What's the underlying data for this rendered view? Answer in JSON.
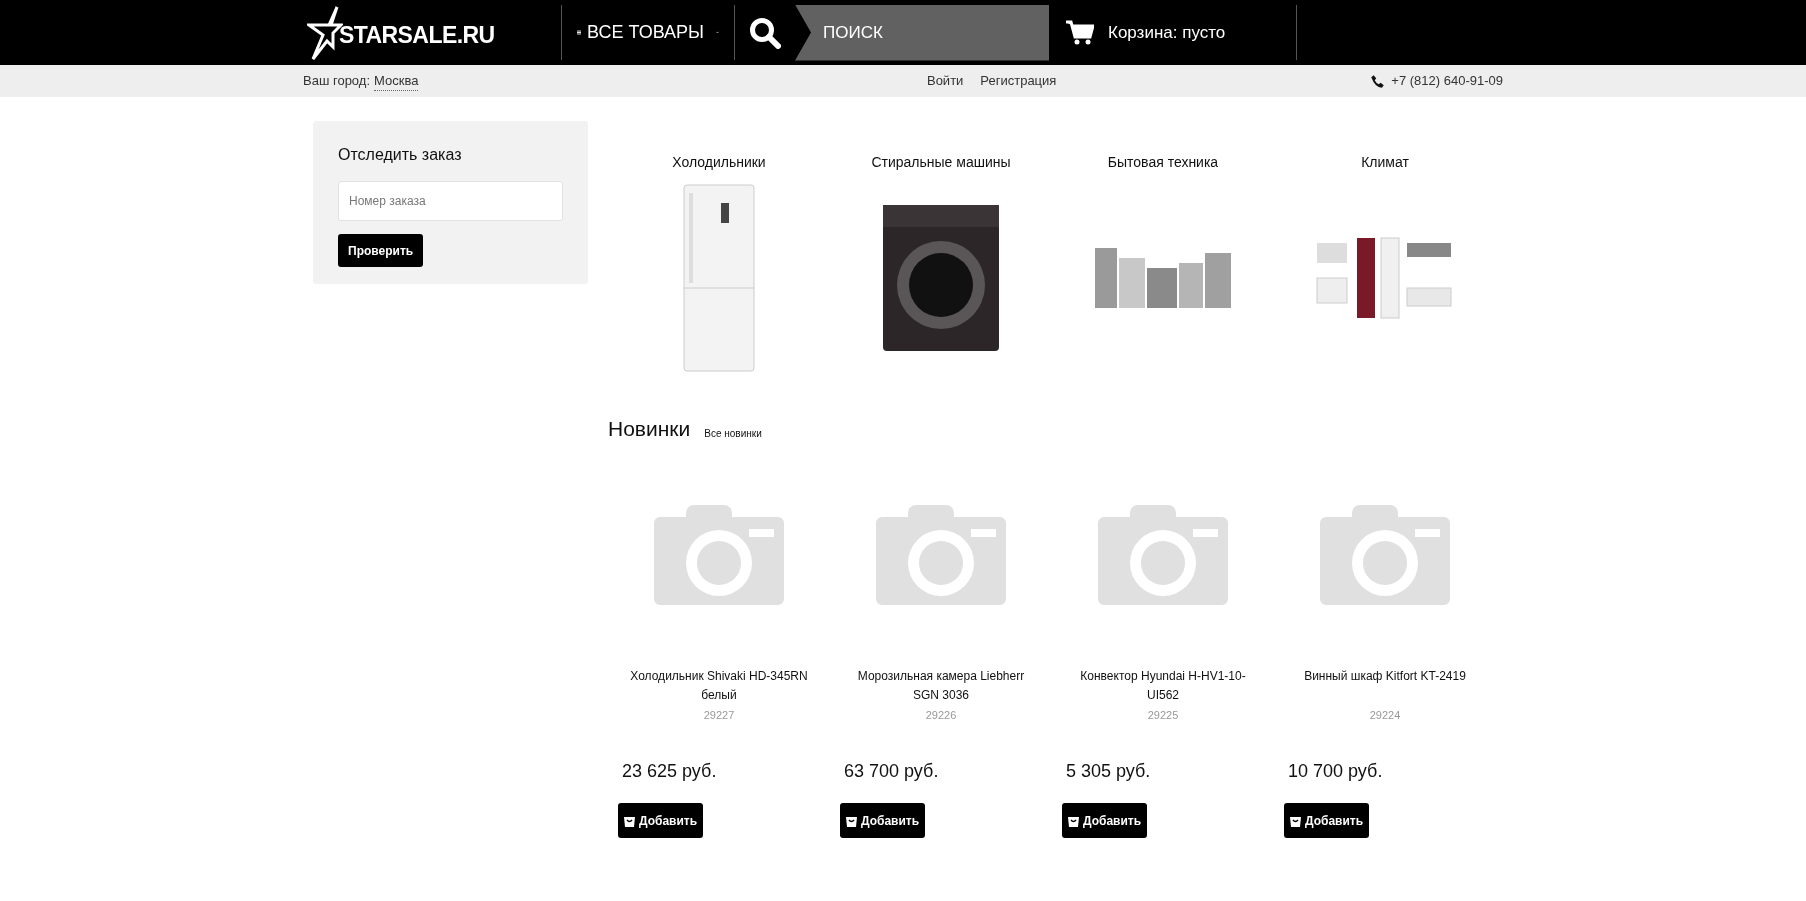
{
  "header": {
    "logo": "STARSALE.RU",
    "catalog_menu": "ВСЕ ТОВАРЫ",
    "search": {
      "placeholder": "ПОИСК"
    },
    "cart": "Корзина: пусто"
  },
  "subbar": {
    "city_label": "Ваш город:",
    "city": "Москва",
    "links": [
      "Войти",
      "Регистрация"
    ],
    "phone": "+7 (812) 640-91-09"
  },
  "track_order": {
    "title": "Отследить заказ",
    "field": {
      "placeholder": "Номер заказа"
    },
    "button": "Проверить"
  },
  "categories": [
    {
      "label": "Холодильники",
      "kind": "fridge"
    },
    {
      "label": "Стиральные машины",
      "kind": "washer"
    },
    {
      "label": "Бытовая техника",
      "kind": "appliances"
    },
    {
      "label": "Климат",
      "kind": "climate"
    }
  ],
  "new_items": {
    "title": "Новинки",
    "all_link": "Все новинки",
    "products": [
      {
        "name": "Холодильник Shivaki HD-345RN белый",
        "id": "29227",
        "price": "23 625 руб.",
        "button": "Добавить"
      },
      {
        "name": "Морозильная камера Liebherr SGN 3036",
        "id": "29226",
        "price": "63 700 руб.",
        "button": "Добавить"
      },
      {
        "name": "Конвектор Hyundai H-HV1-10-UI562",
        "id": "29225",
        "price": "5 305 руб.",
        "button": "Добавить"
      },
      {
        "name": "Винный шкаф Kitfort KT-2419",
        "id": "29224",
        "price": "10 700 руб.",
        "button": "Добавить"
      }
    ]
  }
}
